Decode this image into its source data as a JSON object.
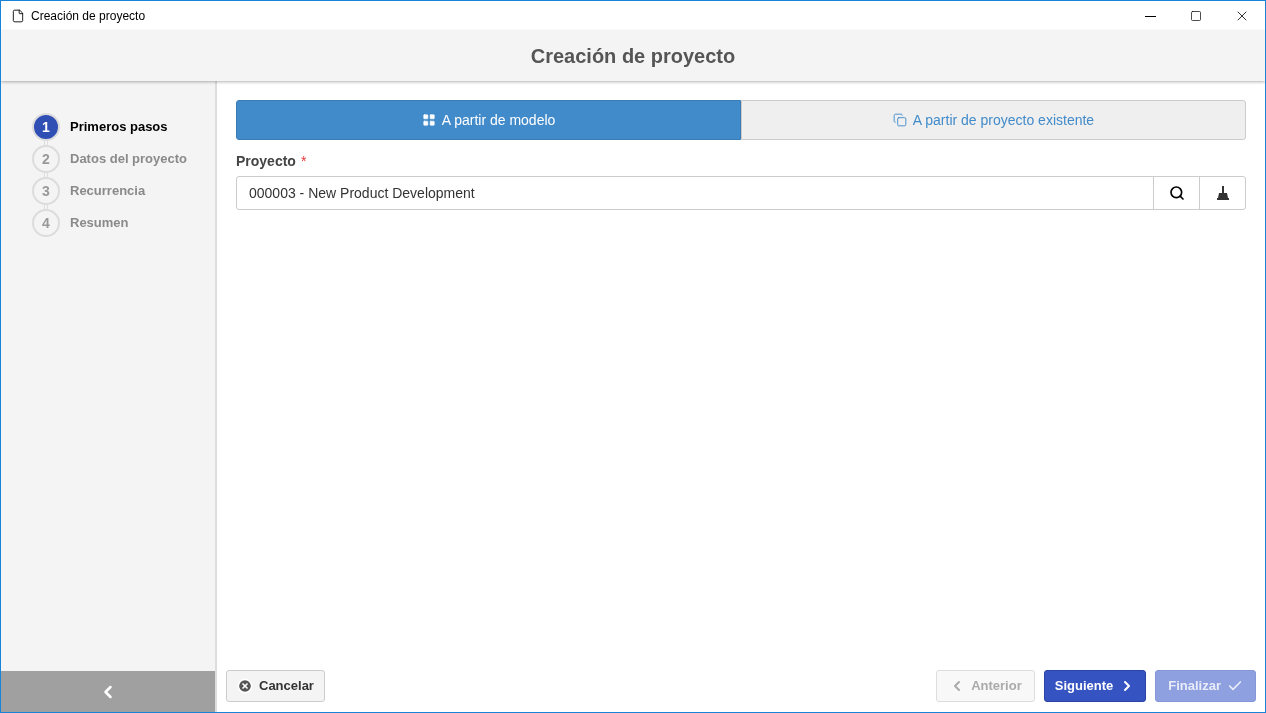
{
  "window": {
    "title": "Creación de proyecto"
  },
  "header": {
    "title": "Creación de proyecto"
  },
  "steps": [
    {
      "number": "1",
      "label": "Primeros pasos",
      "selected": true
    },
    {
      "number": "2",
      "label": "Datos del proyecto",
      "selected": false
    },
    {
      "number": "3",
      "label": "Recurrencia",
      "selected": false
    },
    {
      "number": "4",
      "label": "Resumen",
      "selected": false
    }
  ],
  "tabs": [
    {
      "label": "A partir de modelo",
      "kind": "model",
      "selected": true
    },
    {
      "label": "A partir de proyecto existente",
      "kind": "copy",
      "selected": false
    }
  ],
  "project_field": {
    "label": "Proyecto",
    "required_marker": "*",
    "value": "000003 - New Product Development"
  },
  "footer": {
    "cancel": "Cancelar",
    "previous": {
      "label": "Anterior",
      "disabled": true
    },
    "next": {
      "label": "Siguiente",
      "disabled": false
    },
    "finish": {
      "label": "Finalizar",
      "disabled": true
    }
  }
}
